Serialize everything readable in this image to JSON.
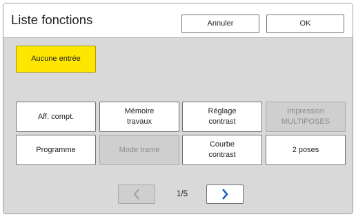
{
  "header": {
    "title": "Liste fonctions",
    "cancel_label": "Annuler",
    "ok_label": "OK"
  },
  "status": {
    "no_entry_label": "Aucune entrée"
  },
  "functions": {
    "row1": [
      {
        "label": "Aff. compt.",
        "enabled": true
      },
      {
        "label": "Mémoire travaux",
        "enabled": true
      },
      {
        "label": "Réglage contrast",
        "enabled": true
      },
      {
        "label": "Impression MULTIPOSES",
        "enabled": false
      }
    ],
    "row2": [
      {
        "label": "Programme",
        "enabled": true
      },
      {
        "label": "Mode trame",
        "enabled": false
      },
      {
        "label": "Courbe contrast",
        "enabled": true
      },
      {
        "label": "2 poses",
        "enabled": true
      }
    ]
  },
  "pager": {
    "page_indicator": "1/5",
    "prev_enabled": false,
    "next_enabled": true
  },
  "colors": {
    "accent_yellow": "#ffe600",
    "arrow_blue": "#1f5fbf",
    "background_gray": "#d9d9d9"
  }
}
